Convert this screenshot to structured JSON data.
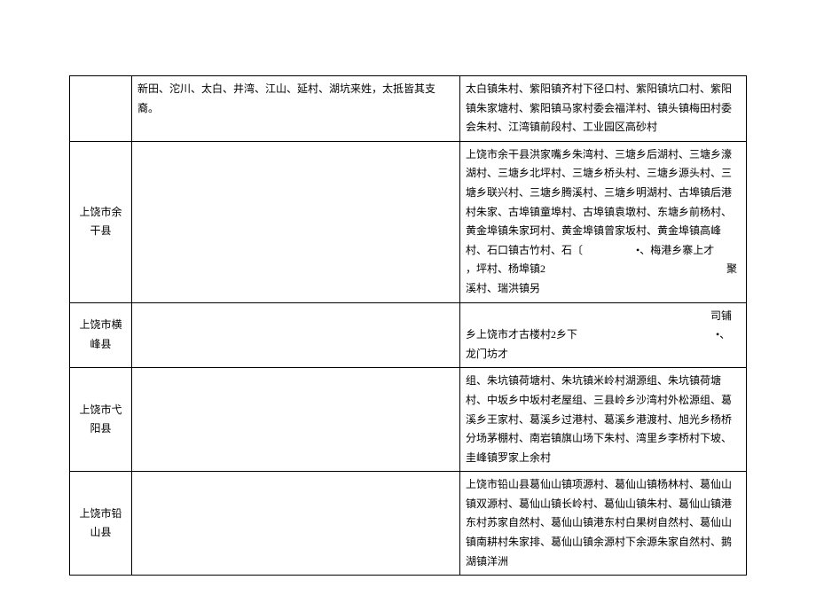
{
  "rows": [
    {
      "col1": "",
      "col2": "新田、沱川、太白、井湾、江山、延村、湖坑来姓，太抵皆其支裔。",
      "col3": "太白镇朱村、紫阳镇齐村下径口村、紫阳镇坑口村、紫阳镇朱家塘村、紫阳镇马家村委会福洋村、镇头镇梅田村委会朱村、江湾镇前段村、工业园区高砂村"
    },
    {
      "col1": "上饶市余干县",
      "col2": "",
      "col3": "上饶市余干县洪家嘴乡朱湾村、三塘乡后湖村、三塘乡濠湖村、三塘乡北坪村、三塘乡桥头村、三塘乡源头村、三塘乡联兴村、三塘乡腾溪村、三塘乡明湖村、古埠镇后港村朱家、古埠镇童埠村、古埠镇袁墩村、东塘乡前杨村、黄金埠镇朱家珂村、黄金埠镇曾家坂村、黄金埠镇高峰村、石口镇古竹村、石〔　　　　　•、梅港乡寨上才　　　　　　　　　　　　　　　　　，坪村、杨埠镇2　　　　　　　　　　　　　　　　　聚溪村、瑞洪镇另"
    },
    {
      "col1": "上饶市横峰县",
      "col2": "",
      "col3": "　　　　　　　　　　　　　　　　　　　　　　　司铺乡上饶市才古楼村2乡下　　　　　　　　　　　　　•、龙门坊才"
    },
    {
      "col1": "上饶市弋阳县",
      "col2": "",
      "col3": "组、朱坑镇荷塘村、朱坑镇米岭村湖源组、朱坑镇荷塘村、中坂乡中坂村老屋组、三县岭乡沙湾村外松源组、葛溪乡王家村、葛溪乡过港村、葛溪乡港渡村、旭光乡杨桥分场茅棚村、南岩镇旗山场下朱村、湾里乡李桥村下坡、圭峰镇罗家上余村"
    },
    {
      "col1": "上饶市铅山县",
      "col2": "",
      "col3": "上饶市铅山县葛仙山镇项源村、葛仙山镇杨林村、葛仙山镇双源村、葛仙山镇长岭村、葛仙山镇朱村、葛仙山镇港东村苏家自然村、葛仙山镇港东村白果树自然村、葛仙山镇南耕村朱家排、葛仙山镇余源村下余源朱家自然村、鹅湖镇洋洲"
    }
  ]
}
